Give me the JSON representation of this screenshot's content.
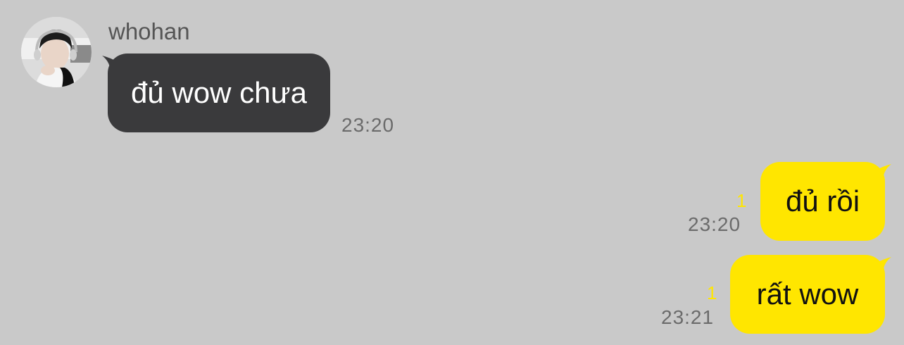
{
  "chat": {
    "messages": [
      {
        "direction": "incoming",
        "sender": "whohan",
        "text": "đủ wow chưa",
        "time": "23:20"
      },
      {
        "direction": "outgoing",
        "text": "đủ rồi",
        "time": "23:20",
        "unread": "1"
      },
      {
        "direction": "outgoing",
        "text": "rất wow",
        "time": "23:21",
        "unread": "1"
      }
    ]
  },
  "colors": {
    "background": "#c9c9c9",
    "incoming_bubble": "#3a3a3c",
    "outgoing_bubble": "#ffe600",
    "unread_count": "#ffe600",
    "timestamp": "#6b6b6b"
  },
  "icons": {
    "avatar": "profile-photo"
  }
}
